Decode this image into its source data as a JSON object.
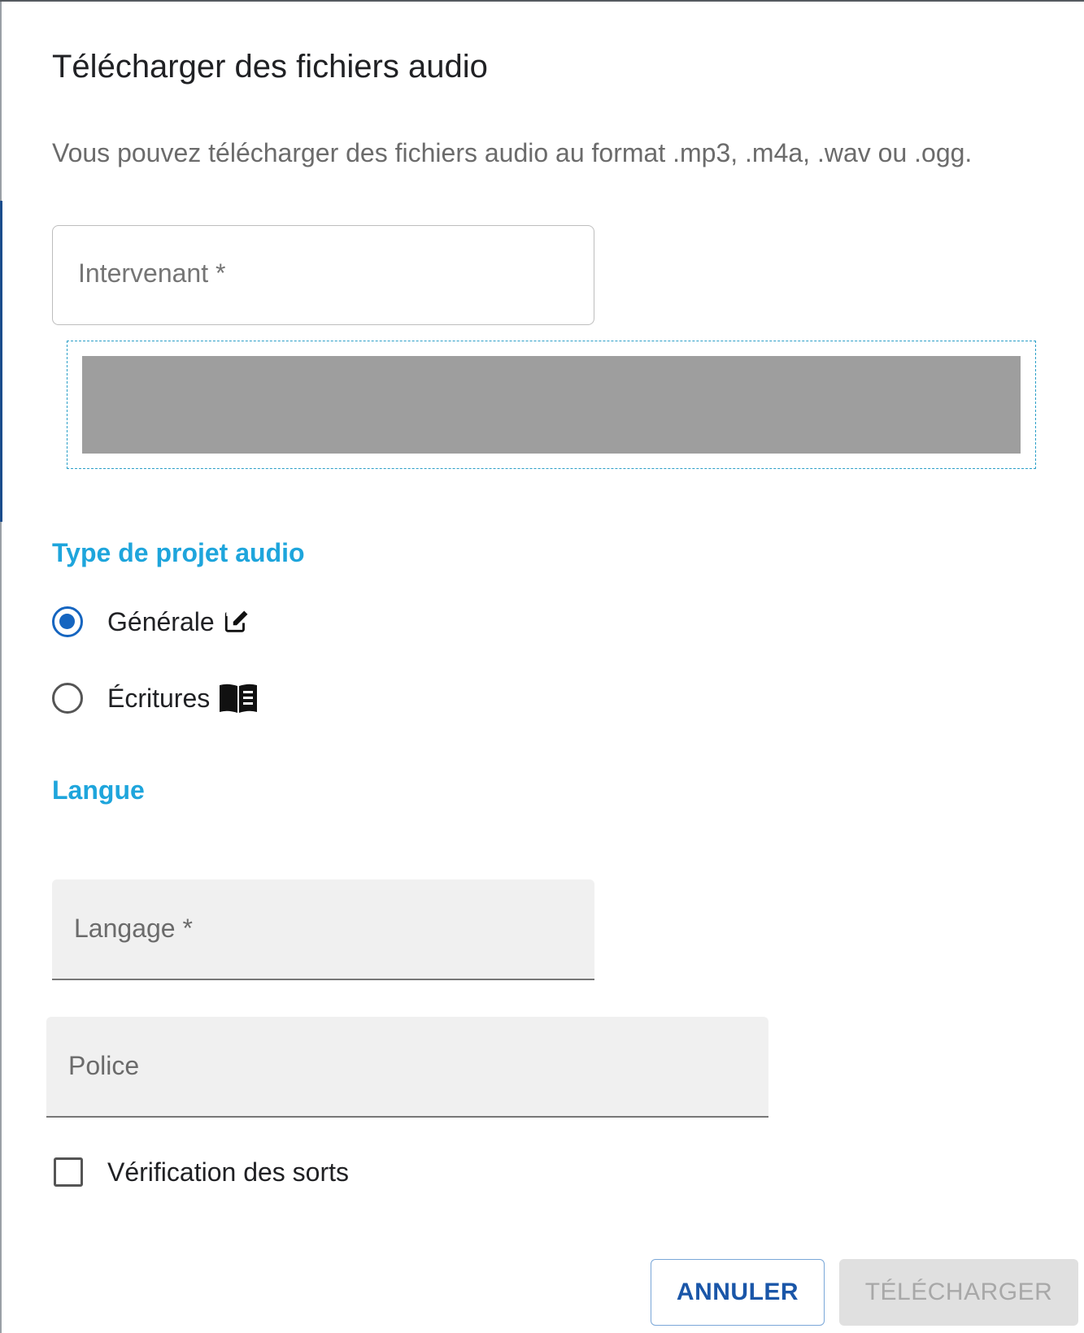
{
  "dialog": {
    "title": "Télécharger des fichiers audio",
    "description": "Vous pouvez télécharger des fichiers audio au format .mp3, .m4a, .wav ou .ogg."
  },
  "speaker_field": {
    "label": "Intervenant *",
    "value": ""
  },
  "project_type": {
    "label": "Type de projet audio",
    "options": [
      {
        "label": "Générale",
        "icon": "edit-icon",
        "checked": true
      },
      {
        "label": "Écritures",
        "icon": "book-icon",
        "checked": false
      }
    ]
  },
  "language_section": {
    "label": "Langue"
  },
  "language_field": {
    "label": "Langage *",
    "value": ""
  },
  "font_field": {
    "label": "Police",
    "value": ""
  },
  "spell_check": {
    "label": "Vérification des sorts",
    "checked": false
  },
  "buttons": {
    "cancel": "ANNULER",
    "upload": "TÉLÉCHARGER"
  },
  "colors": {
    "accent": "#1ea5dc",
    "primary": "#1565c0",
    "dropzone_border": "#2b9fc8",
    "dropzone_fill": "#9e9e9e"
  }
}
